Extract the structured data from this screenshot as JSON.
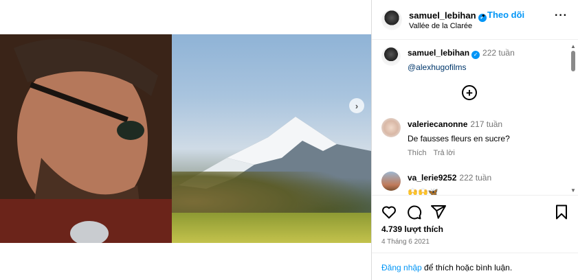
{
  "post": {
    "username": "samuel_lebihan",
    "verified": true,
    "separator": "•",
    "follow_label": "Theo dõi",
    "location": "Vallée de la Clarée",
    "more_label": "···"
  },
  "media": {
    "next_label": "›"
  },
  "comments": [
    {
      "username": "samuel_lebihan",
      "verified": true,
      "time": "222 tuần",
      "text": "@alexhugofilms"
    },
    {
      "username": "valeriecanonne",
      "time": "217 tuần",
      "text": "De fausses fleurs en sucre?",
      "like_label": "Thích",
      "reply_label": "Trả lời"
    },
    {
      "username": "va_lerie9252",
      "time": "222 tuần",
      "text": "🙌🙌🦋"
    }
  ],
  "load_more_label": "+",
  "engagement": {
    "likes": "4.739 lượt thích",
    "date": "4 Tháng 6 2021"
  },
  "login_prompt": {
    "link": "Đăng nhập",
    "text": " để thích hoặc bình luận."
  },
  "colors": {
    "accent": "#0095f6",
    "mention": "#00376b",
    "muted": "#737373"
  }
}
